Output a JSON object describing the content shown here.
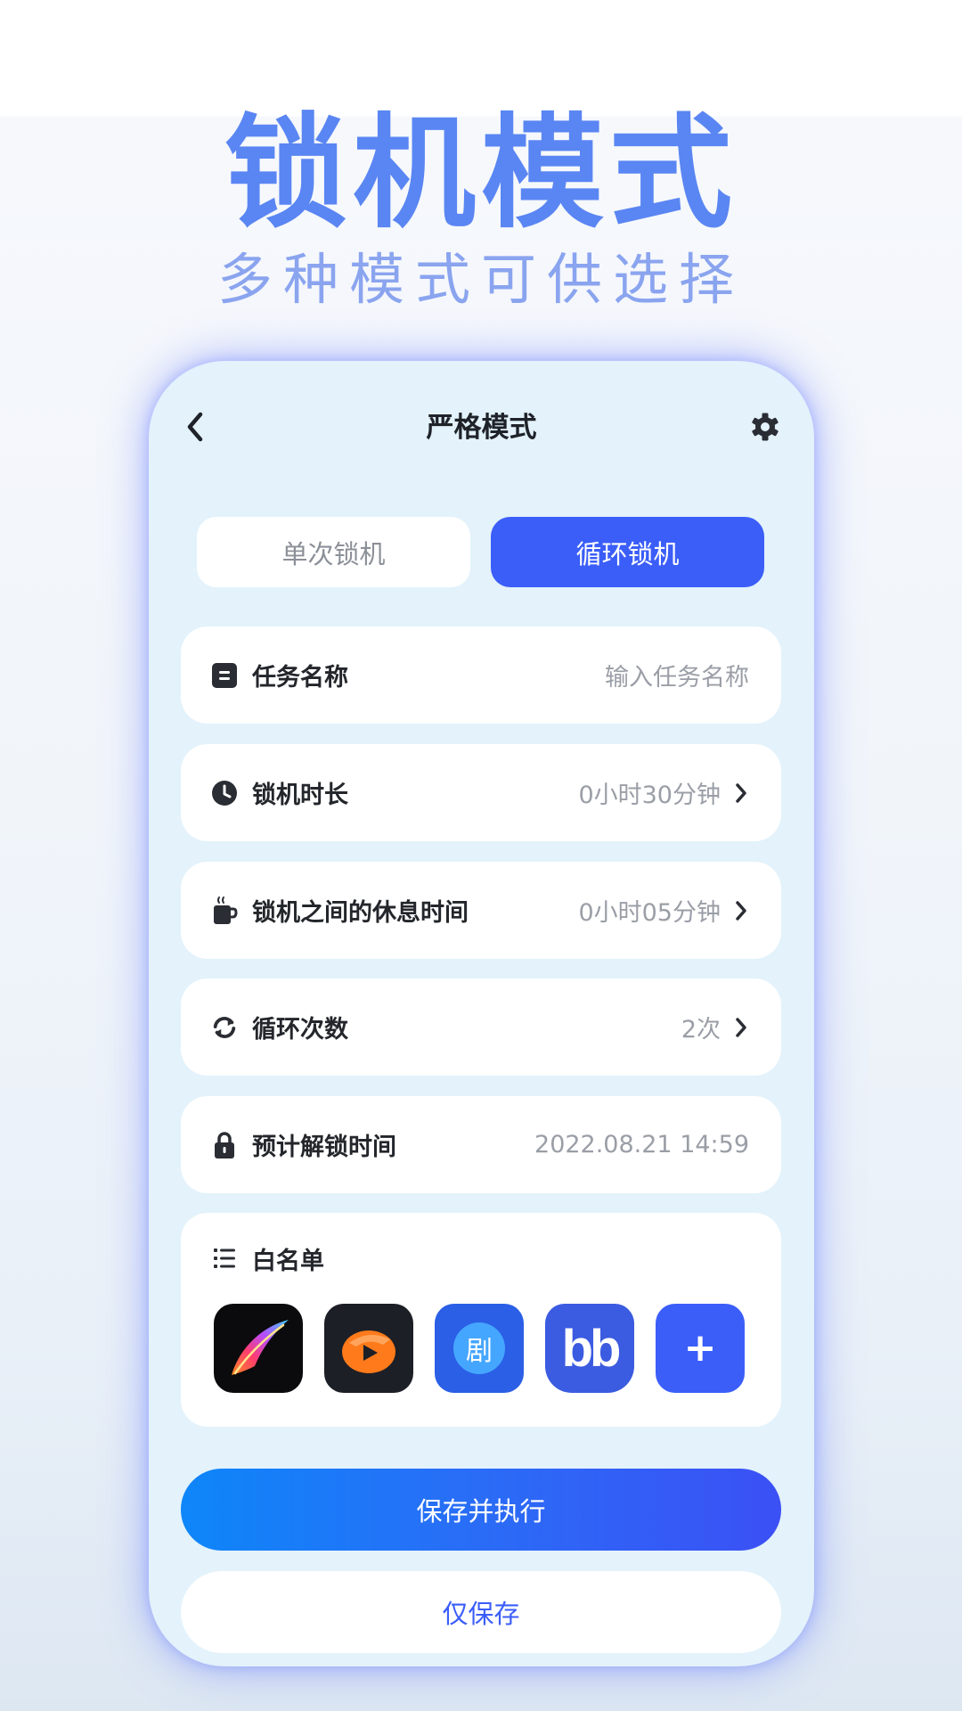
{
  "promo": {
    "title": "锁机模式",
    "subtitle": "多种模式可供选择"
  },
  "header": {
    "title": "严格模式",
    "back_icon": "chevron-left-icon",
    "settings_icon": "gear-icon"
  },
  "tabs": [
    {
      "label": "单次锁机",
      "active": false
    },
    {
      "label": "循环锁机",
      "active": true
    }
  ],
  "rows": [
    {
      "icon": "note-icon",
      "label": "任务名称",
      "value": "输入任务名称",
      "is_placeholder": true,
      "chevron": false
    },
    {
      "icon": "clock-icon",
      "label": "锁机时长",
      "value": "0小时30分钟",
      "chevron": true
    },
    {
      "icon": "coffee-icon",
      "label": "锁机之间的休息时间",
      "value": "0小时05分钟",
      "chevron": true
    },
    {
      "icon": "repeat-icon",
      "label": "循环次数",
      "value": "2次",
      "chevron": true
    },
    {
      "icon": "lock-icon",
      "label": "预计解锁时间",
      "value": "2022.08.21 14:59",
      "chevron": false
    }
  ],
  "whitelist": {
    "icon": "list-icon",
    "label": "白名单",
    "apps": [
      {
        "icon": "procreate-app-icon"
      },
      {
        "icon": "orange-play-app-icon"
      },
      {
        "icon": "drama-app-icon",
        "text": "剧"
      },
      {
        "icon": "bilibili-app-icon",
        "text": "bb"
      },
      {
        "icon": "add-icon",
        "text": "+"
      }
    ]
  },
  "buttons": {
    "save_and_run": "保存并执行",
    "save_only": "仅保存"
  },
  "colors": {
    "accent": "#3b5ef9",
    "promo_title": "#5a86f3",
    "promo_subtitle": "#8aa4ef",
    "phone_bg": "#e3f2fb",
    "muted_text": "#9a9ea6"
  }
}
